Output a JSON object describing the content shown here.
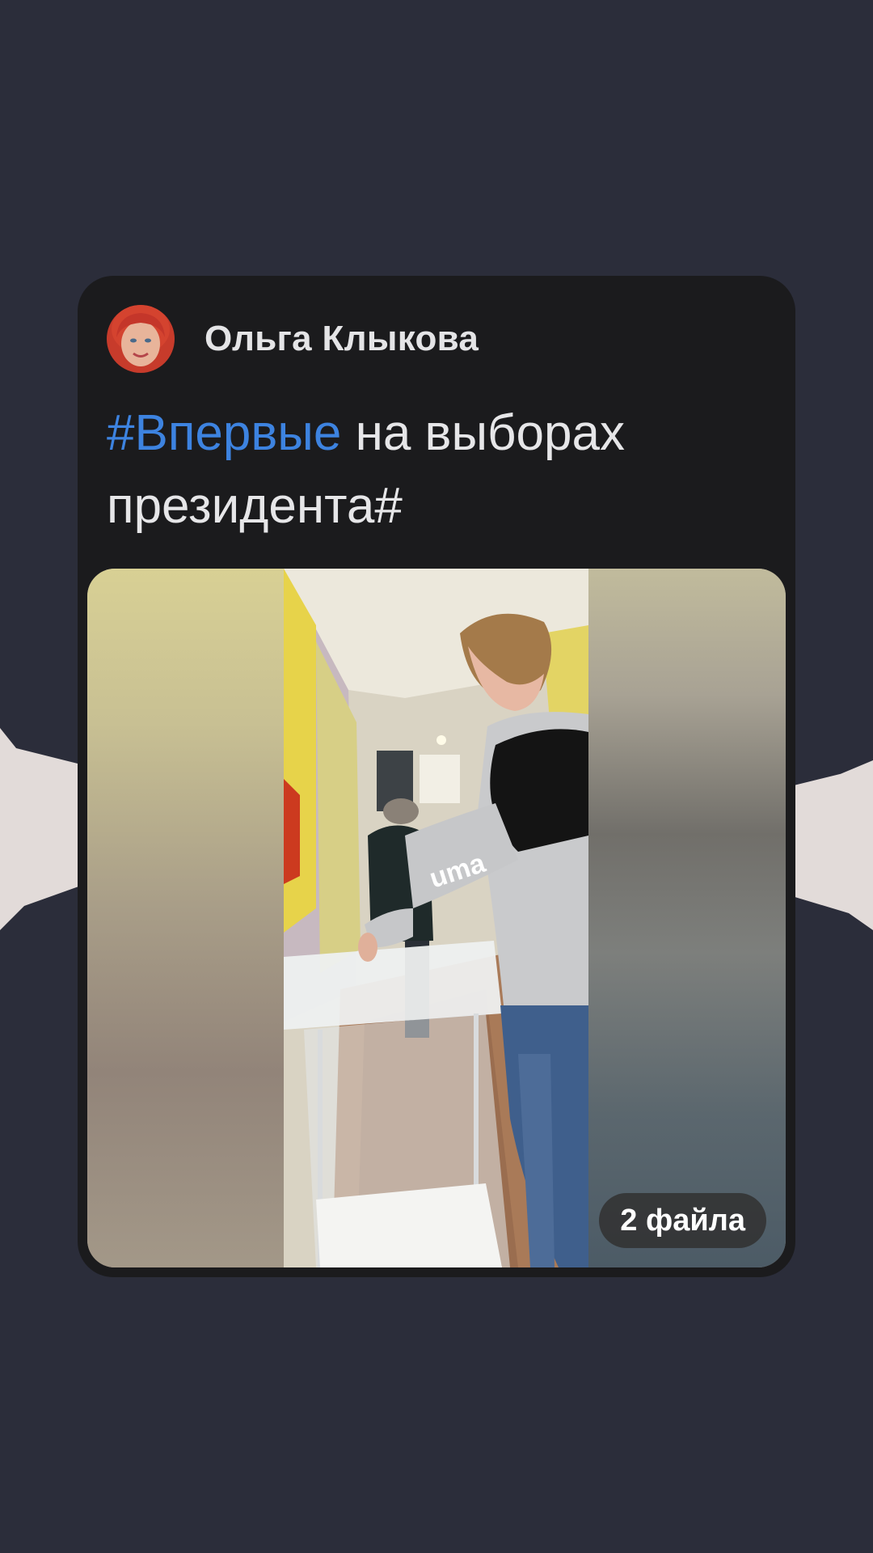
{
  "post": {
    "author_name": "Ольга Клыкова",
    "text_hashtag": "#Впервые",
    "text_rest": " на выборах президента#",
    "media": {
      "file_count_label": "2 файла"
    }
  },
  "colors": {
    "background": "#2b2d3a",
    "card": "#1b1b1d",
    "hashtag": "#3d83e0",
    "text": "#e6e6e8"
  },
  "icons": {
    "avatar": "author-avatar-photo"
  }
}
